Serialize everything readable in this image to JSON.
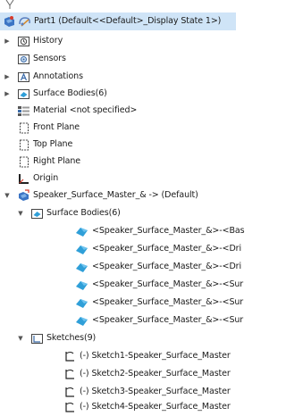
{
  "tree": {
    "root": {
      "label": "Part1  (Default<<Default>_Display State 1>)"
    },
    "items": [
      {
        "label": "History"
      },
      {
        "label": "Sensors"
      },
      {
        "label": "Annotations"
      },
      {
        "label": "Surface Bodies(6)"
      },
      {
        "label": "Material <not specified>"
      },
      {
        "label": "Front Plane"
      },
      {
        "label": "Top Plane"
      },
      {
        "label": "Right Plane"
      },
      {
        "label": "Origin"
      },
      {
        "label": "Speaker_Surface_Master_& -> (Default)"
      }
    ],
    "child_surface_bodies": {
      "label": "Surface Bodies(6)"
    },
    "surface_bodies": [
      {
        "label": "<Speaker_Surface_Master_&>-<Bas"
      },
      {
        "label": "<Speaker_Surface_Master_&>-<Dri"
      },
      {
        "label": "<Speaker_Surface_Master_&>-<Dri"
      },
      {
        "label": "<Speaker_Surface_Master_&>-<Sur"
      },
      {
        "label": "<Speaker_Surface_Master_&>-<Sur"
      },
      {
        "label": "<Speaker_Surface_Master_&>-<Sur"
      }
    ],
    "sketches_folder": {
      "label": "Sketches(9)"
    },
    "sketches": [
      {
        "label": "(-) Sketch1-Speaker_Surface_Master"
      },
      {
        "label": "(-) Sketch2-Speaker_Surface_Master"
      },
      {
        "label": "(-) Sketch3-Speaker_Surface_Master"
      },
      {
        "label": "(-) Sketch4-Speaker_Surface_Master"
      }
    ]
  },
  "colors": {
    "selection": "#cfe4f7",
    "surface_body_icon": "#2f9fd8",
    "part_icon": "#3b74c4",
    "part_icon_accent": "#d83a2a"
  }
}
